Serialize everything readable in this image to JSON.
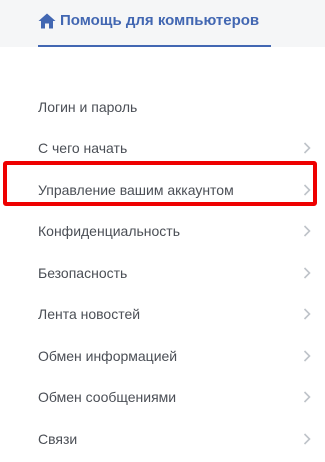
{
  "header": {
    "title": "Помощь для компьютеров",
    "icon": "home-icon",
    "accent_color": "#4267b2",
    "background": "#f5f6f7"
  },
  "menu": {
    "items": [
      {
        "label": "Логин и пароль",
        "has_chevron": false
      },
      {
        "label": "С чего начать",
        "has_chevron": true
      },
      {
        "label": "Управление вашим аккаунтом",
        "has_chevron": true,
        "highlighted": true
      },
      {
        "label": "Конфиденциальность",
        "has_chevron": true
      },
      {
        "label": "Безопасность",
        "has_chevron": true
      },
      {
        "label": "Лента новостей",
        "has_chevron": true
      },
      {
        "label": "Обмен информацией",
        "has_chevron": true
      },
      {
        "label": "Обмен сообщениями",
        "has_chevron": true
      },
      {
        "label": "Связи",
        "has_chevron": true
      }
    ],
    "chevron_icon": "chevron-right-icon",
    "text_color": "#4b4f56",
    "chevron_color": "#bec3c9"
  },
  "annotation": {
    "highlight_color": "#ee0000"
  }
}
